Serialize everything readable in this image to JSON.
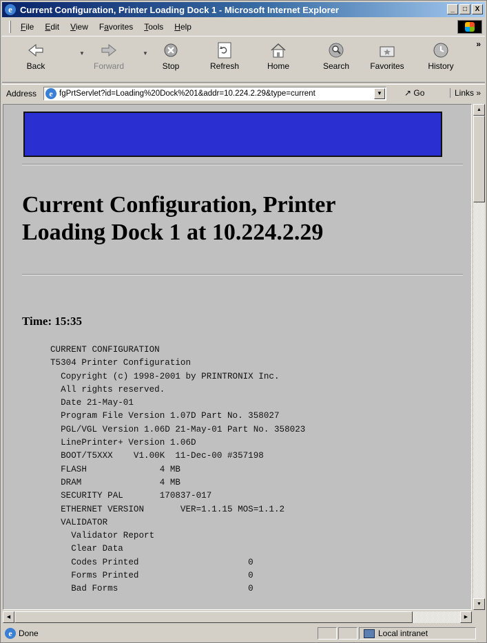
{
  "window": {
    "title": "Current Configuration, Printer Loading Dock 1 - Microsoft Internet Explorer",
    "controls": {
      "minimize": "_",
      "maximize": "□",
      "close": "X"
    }
  },
  "menu": {
    "items": [
      {
        "label": "File",
        "accel": "F",
        "rest": "ile"
      },
      {
        "label": "Edit",
        "accel": "E",
        "rest": "dit"
      },
      {
        "label": "View",
        "accel": "V",
        "rest": "iew"
      },
      {
        "label": "Favorites",
        "accel": "a",
        "pre": "F",
        "rest": "vorites"
      },
      {
        "label": "Tools",
        "accel": "T",
        "rest": "ools"
      },
      {
        "label": "Help",
        "accel": "H",
        "rest": "elp"
      }
    ]
  },
  "toolbar": {
    "back": "Back",
    "forward": "Forward",
    "stop": "Stop",
    "refresh": "Refresh",
    "home": "Home",
    "search": "Search",
    "favorites": "Favorites",
    "history": "History",
    "more": "»"
  },
  "address": {
    "label": "Address",
    "url": "fgPrtServlet?id=Loading%20Dock%201&addr=10.224.2.29&type=current",
    "go": "Go",
    "links": "Links »"
  },
  "page": {
    "heading_line1": "Current Configuration, Printer",
    "heading_line2": "Loading Dock 1 at 10.224.2.29",
    "time": "Time: 15:35",
    "config_text": "CURRENT CONFIGURATION\nT5304 Printer Configuration\n  Copyright (c) 1998-2001 by PRINTRONIX Inc.\n  All rights reserved.\n  Date 21-May-01\n  Program File Version 1.07D Part No. 358027\n  PGL/VGL Version 1.06D 21-May-01 Part No. 358023\n  LinePrinter+ Version 1.06D\n  BOOT/T5XXX    V1.00K  11-Dec-00 #357198\n  FLASH              4 MB\n  DRAM               4 MB\n  SECURITY PAL       170837-017\n  ETHERNET VERSION       VER=1.1.15 MOS=1.1.2\n  VALIDATOR\n    Validator Report\n    Clear Data\n    Codes Printed                     0\n    Forms Printed                     0\n    Bad Forms                         0"
  },
  "status": {
    "text": "Done",
    "zone": "Local intranet"
  },
  "colors": {
    "banner": "#2a2fd2",
    "titlebar_start": "#0a246a",
    "titlebar_end": "#a6caf0",
    "page_background": "#c0c0c0"
  },
  "scroll": {
    "vertical_position": 0
  }
}
